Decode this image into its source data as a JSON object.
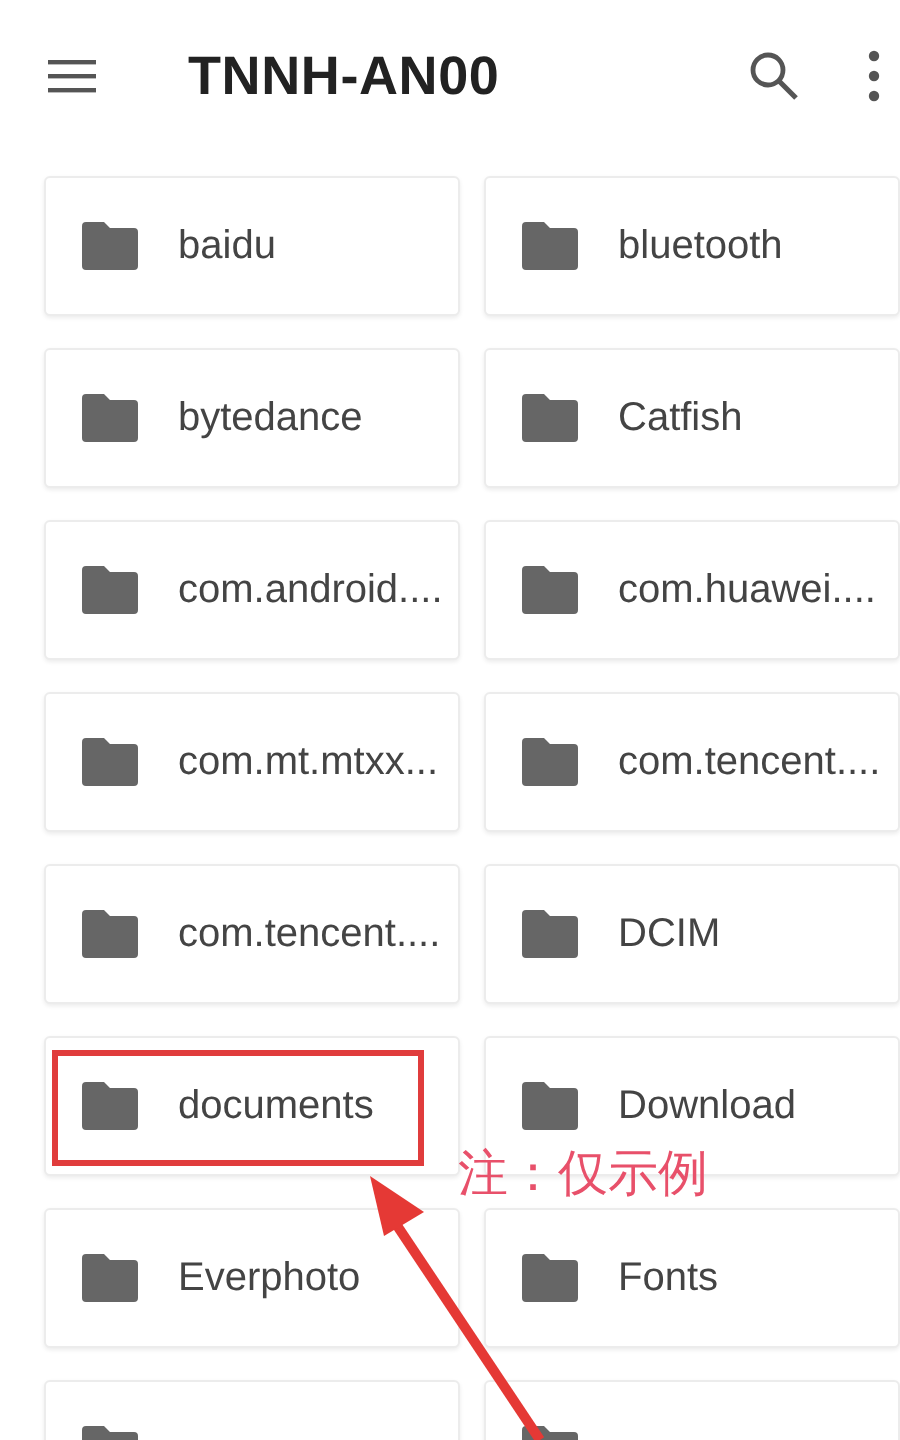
{
  "app_bar": {
    "title": "TNNH-AN00"
  },
  "folders": [
    {
      "name": "baidu"
    },
    {
      "name": "bluetooth"
    },
    {
      "name": "bytedance"
    },
    {
      "name": "Catfish"
    },
    {
      "name": "com.android...."
    },
    {
      "name": "com.huawei...."
    },
    {
      "name": "com.mt.mtxx..."
    },
    {
      "name": "com.tencent...."
    },
    {
      "name": "com.tencent...."
    },
    {
      "name": "DCIM"
    },
    {
      "name": "documents",
      "highlighted": true
    },
    {
      "name": "Download"
    },
    {
      "name": "Everphoto"
    },
    {
      "name": "Fonts"
    },
    {
      "kind": "folder"
    },
    {
      "kind": "folder"
    }
  ],
  "annotation": {
    "note": "注：仅示例"
  }
}
